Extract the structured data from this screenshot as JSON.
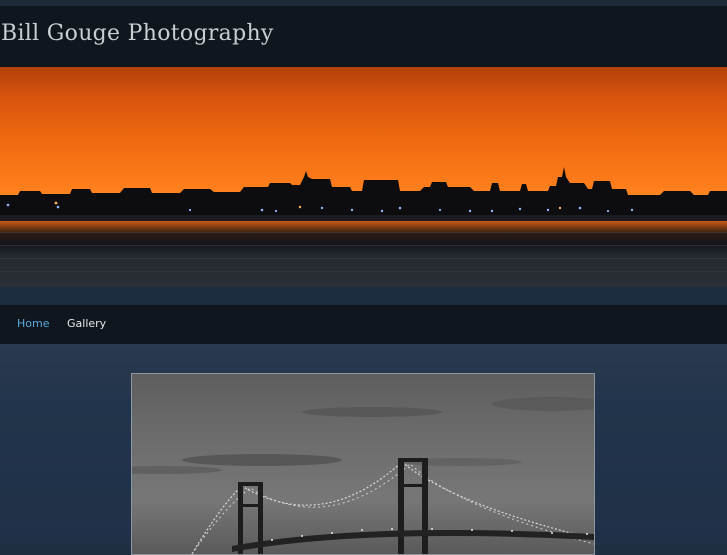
{
  "site": {
    "title": "Bill Gouge Photography"
  },
  "nav": {
    "items": [
      {
        "label": "Home",
        "active": true
      },
      {
        "label": "Gallery",
        "active": false
      }
    ]
  },
  "colors": {
    "header_bg": "#0f161d",
    "page_bg": "#1f2f42",
    "nav_active": "#5aa9dc",
    "nav_text": "#e6e8ea",
    "title_text": "#c9ced2"
  },
  "images": {
    "banner": "sunset-skyline-image",
    "featured": "bridge-photo-image"
  }
}
